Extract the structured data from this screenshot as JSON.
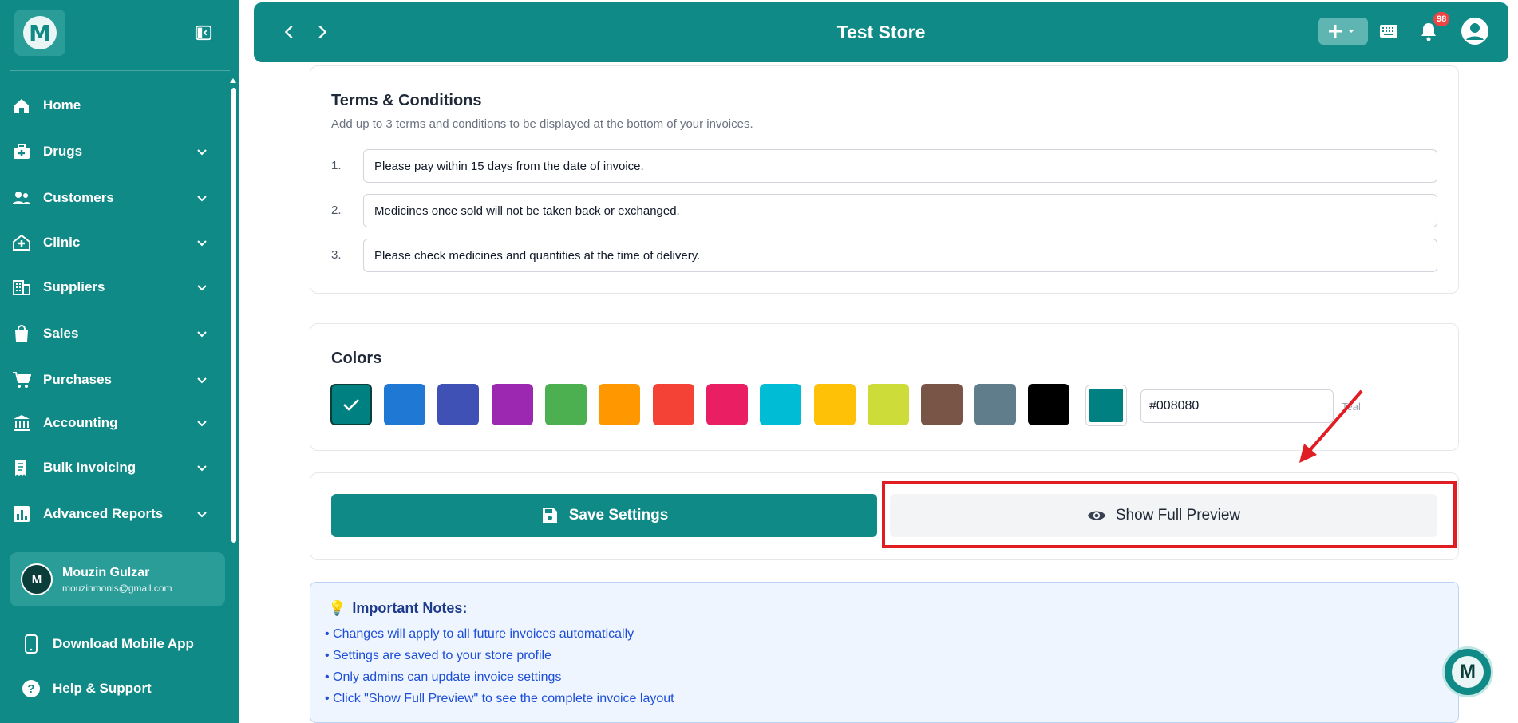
{
  "app": {
    "logo_letter": "M",
    "brand_color": "#0f8a86"
  },
  "sidebar": {
    "items": [
      {
        "label": "Home",
        "icon": "home-icon",
        "has_chevron": false
      },
      {
        "label": "Drugs",
        "icon": "medical-kit-icon",
        "has_chevron": true
      },
      {
        "label": "Customers",
        "icon": "people-icon",
        "has_chevron": true
      },
      {
        "label": "Clinic",
        "icon": "clinic-icon",
        "has_chevron": true
      },
      {
        "label": "Suppliers",
        "icon": "building-icon",
        "has_chevron": true
      },
      {
        "label": "Sales",
        "icon": "shopping-bag-icon",
        "has_chevron": true
      },
      {
        "label": "Purchases",
        "icon": "cart-icon",
        "has_chevron": true
      },
      {
        "label": "Accounting",
        "icon": "bank-icon",
        "has_chevron": true
      },
      {
        "label": "Bulk Invoicing",
        "icon": "invoice-icon",
        "has_chevron": true
      },
      {
        "label": "Advanced Reports",
        "icon": "bar-chart-icon",
        "has_chevron": true
      }
    ],
    "user": {
      "initial": "M",
      "name": "Mouzin Gulzar",
      "email": "mouzinmonis@gmail.com"
    },
    "download_app": "Download Mobile App",
    "help": "Help & Support"
  },
  "header": {
    "title": "Test Store",
    "notification_count": "98"
  },
  "terms": {
    "title": "Terms & Conditions",
    "subtitle": "Add up to 3 terms and conditions to be displayed at the bottom of your invoices.",
    "items": [
      {
        "num": "1.",
        "value": "Please pay within 15 days from the date of invoice."
      },
      {
        "num": "2.",
        "value": "Medicines once sold will not be taken back or exchanged."
      },
      {
        "num": "3.",
        "value": "Please check medicines and quantities at the time of delivery."
      }
    ]
  },
  "colors": {
    "title": "Colors",
    "swatches": [
      "#008080",
      "#1e78d4",
      "#3f51b5",
      "#9c27b0",
      "#4caf50",
      "#ff9800",
      "#f44336",
      "#e91e63",
      "#00bcd4",
      "#ffc107",
      "#cddc39",
      "#795548",
      "#607d8b",
      "#000000"
    ],
    "selected_index": 0,
    "custom_swatch": "#008080",
    "hex_value": "#008080",
    "selected_name": "Teal"
  },
  "actions": {
    "save_label": "Save Settings",
    "preview_label": "Show Full Preview"
  },
  "notes": {
    "emoji": "💡",
    "title": "Important Notes:",
    "lines": [
      "• Changes will apply to all future invoices automatically",
      "• Settings are saved to your store profile",
      "• Only admins can update invoice settings",
      "• Click \"Show Full Preview\" to see the complete invoice layout"
    ]
  },
  "chat": {
    "letter": "M"
  }
}
